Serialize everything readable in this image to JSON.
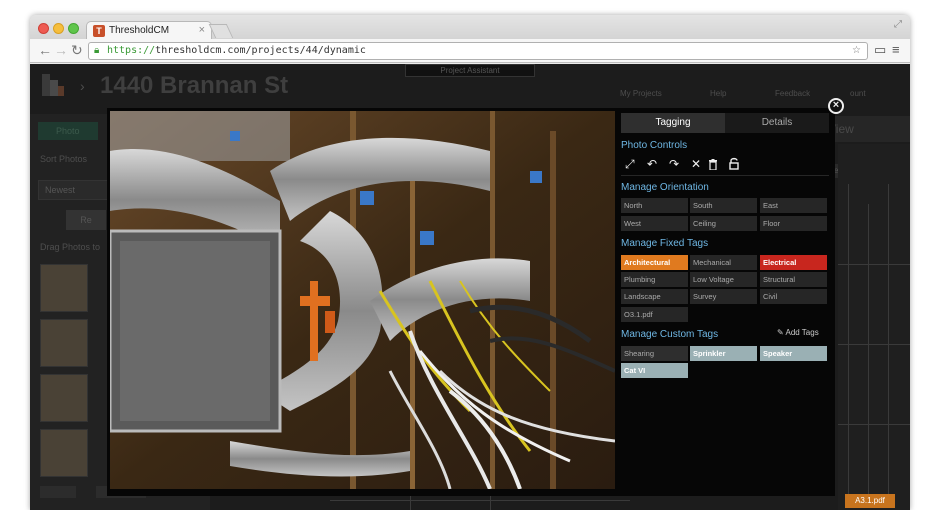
{
  "browser": {
    "tab_title": "ThresholdCM",
    "favicon_letter": "T",
    "url_scheme": "https://",
    "url_rest": "thresholdcm.com/projects/44/dynamic"
  },
  "background": {
    "project_title": "1440 Brannan St",
    "project_assistant": "Project Assistant",
    "photo_button": "Photo",
    "sort_photos": "Sort Photos",
    "sort_value": "Newest",
    "reset": "Re",
    "drag_hint": "Drag Photos to",
    "nav_my_projects": "My Projects",
    "nav_help": "Help",
    "nav_feedback": "Feedback",
    "nav_account": "ount",
    "view_label": "View",
    "discipline_select": "ectural",
    "drawing_badge": "A3.1.pdf"
  },
  "modal": {
    "tabs": [
      "Tagging",
      "Details"
    ],
    "photo_controls_label": "Photo Controls",
    "orientation_label": "Manage Orientation",
    "orientation_options": [
      "North",
      "South",
      "East",
      "West",
      "Ceiling",
      "Floor"
    ],
    "fixed_tags_label": "Manage Fixed Tags",
    "fixed_tags": [
      "Architectural",
      "Mechanical",
      "Electrical",
      "Plumbing",
      "Low Voltage",
      "Structural",
      "Landscape",
      "Survey",
      "Civil",
      "O3.1.pdf"
    ],
    "custom_tags_label": "Manage Custom Tags",
    "add_tags_label": "Add Tags",
    "custom_tags": [
      "Shearing",
      "Sprinkler",
      "Speaker",
      "Cat VI"
    ]
  },
  "colors": {
    "section_heading": "#6fb7e4",
    "architectural_tag": "#e07a1f",
    "electrical_tag": "#c8261e",
    "active_custom_tag": "#9ab0b4"
  }
}
